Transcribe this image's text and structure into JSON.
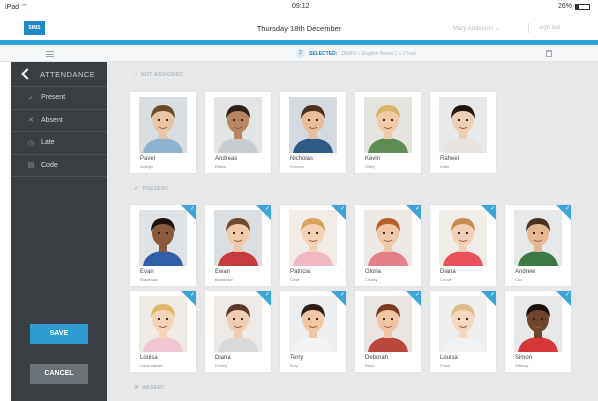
{
  "status_bar": {
    "device": "iPad ⌔",
    "time": "09:12",
    "battery_text": "26%",
    "battery_level": 0.26
  },
  "header": {
    "logo": "SIMS",
    "date": "Thursday 18th December",
    "user": "Mary Anderson ⌄",
    "sign_out": "sign out"
  },
  "subbar": {
    "count": "2",
    "selected_label": "SELECTED:",
    "breadcrumbs": "DEMO  »  English Room 1  »  2Trad"
  },
  "sidebar": {
    "title": "ATTENDANCE",
    "items": [
      {
        "icon": "check-icon",
        "glyph": "✓",
        "label": "Present"
      },
      {
        "icon": "cross-icon",
        "glyph": "✕",
        "label": "Absent"
      },
      {
        "icon": "clock-icon",
        "glyph": "◷",
        "label": "Late"
      },
      {
        "icon": "code-icon",
        "glyph": "▤",
        "label": "Code"
      }
    ],
    "save": "SAVE",
    "cancel": "CANCEL"
  },
  "sections": {
    "not_assigned": "NOT ASSIGNED",
    "present": "PRESENT",
    "absent": "ABSENT"
  },
  "not_assigned": [
    {
      "first": "Pavel",
      "last": "Andrijič",
      "skin": "#e8c4a6",
      "hair": "#6b4a2b",
      "shirt": "#8fb2cf",
      "bg": "#d8dde0"
    },
    {
      "first": "Andreas",
      "last": "Eltiton",
      "skin": "#b98560",
      "hair": "#2d1f18",
      "shirt": "#c9ccd0",
      "bg": "#e2e4e6"
    },
    {
      "first": "Nicholas",
      "last": "Everton",
      "skin": "#e7bd9a",
      "hair": "#4a3222",
      "shirt": "#2e5a86",
      "bg": "#d4dadf"
    },
    {
      "first": "Kevin",
      "last": "Gilfoy",
      "skin": "#f1cba8",
      "hair": "#d9b36a",
      "shirt": "#5e8c52",
      "bg": "#e6e4de"
    },
    {
      "first": "Raheel",
      "last": "Kabir",
      "skin": "#f0d0b4",
      "hair": "#1f1612",
      "shirt": "#e7e4e0",
      "bg": "#e9e9ea"
    }
  ],
  "present_row1": [
    {
      "first": "Evan",
      "last": "Bradshaw",
      "skin": "#8a5a3b",
      "hair": "#1c120d",
      "shirt": "#2f5fa8",
      "bg": "#dfe3e6"
    },
    {
      "first": "Ewan",
      "last": "Bradshaw",
      "skin": "#f0c9a6",
      "hair": "#6c4a2f",
      "shirt": "#c63b3b",
      "bg": "#dcdfe2"
    },
    {
      "first": "Patricia",
      "last": "Clear",
      "skin": "#f4d2b5",
      "hair": "#d8a45b",
      "shirt": "#f0b9c3",
      "bg": "#f1ece6"
    },
    {
      "first": "Gloria",
      "last": "Clearly",
      "skin": "#f0c8a8",
      "hair": "#b55e2a",
      "shirt": "#e57f8a",
      "bg": "#ece8e4"
    },
    {
      "first": "Diana",
      "last": "Crowe",
      "skin": "#f3d0b7",
      "hair": "#c58d52",
      "shirt": "#ea4f5c",
      "bg": "#f0ece8"
    },
    {
      "first": "Andrew",
      "last": "Cox",
      "skin": "#e5b894",
      "hair": "#4b3324",
      "shirt": "#3b7a46",
      "bg": "#e6e8ea"
    }
  ],
  "present_row2": [
    {
      "first": "Louisa",
      "last": "Cavendishes",
      "skin": "#f5d4b8",
      "hair": "#e0b865",
      "shirt": "#f2c7d3",
      "bg": "#efeae4"
    },
    {
      "first": "Diana",
      "last": "Dewey",
      "skin": "#f2cdb1",
      "hair": "#5a3a26",
      "shirt": "#d9d9d9",
      "bg": "#ece9e6"
    },
    {
      "first": "Terry",
      "last": "Evry",
      "skin": "#f0c7a2",
      "hair": "#2a1d16",
      "shirt": "#f3f3f3",
      "bg": "#eceeef"
    },
    {
      "first": "Deborah",
      "last": "Read",
      "skin": "#f1c5a4",
      "hair": "#7a3a22",
      "shirt": "#b9483b",
      "bg": "#e9e4e1"
    },
    {
      "first": "Louisa",
      "last": "Frank",
      "skin": "#f6d8bf",
      "hair": "#dcc08a",
      "shirt": "#f1f1f1",
      "bg": "#eeeeee"
    },
    {
      "first": "Simon",
      "last": "Stibeay",
      "skin": "#6f452c",
      "hair": "#1a110c",
      "shirt": "#d8373a",
      "bg": "#e8e8e8"
    }
  ]
}
